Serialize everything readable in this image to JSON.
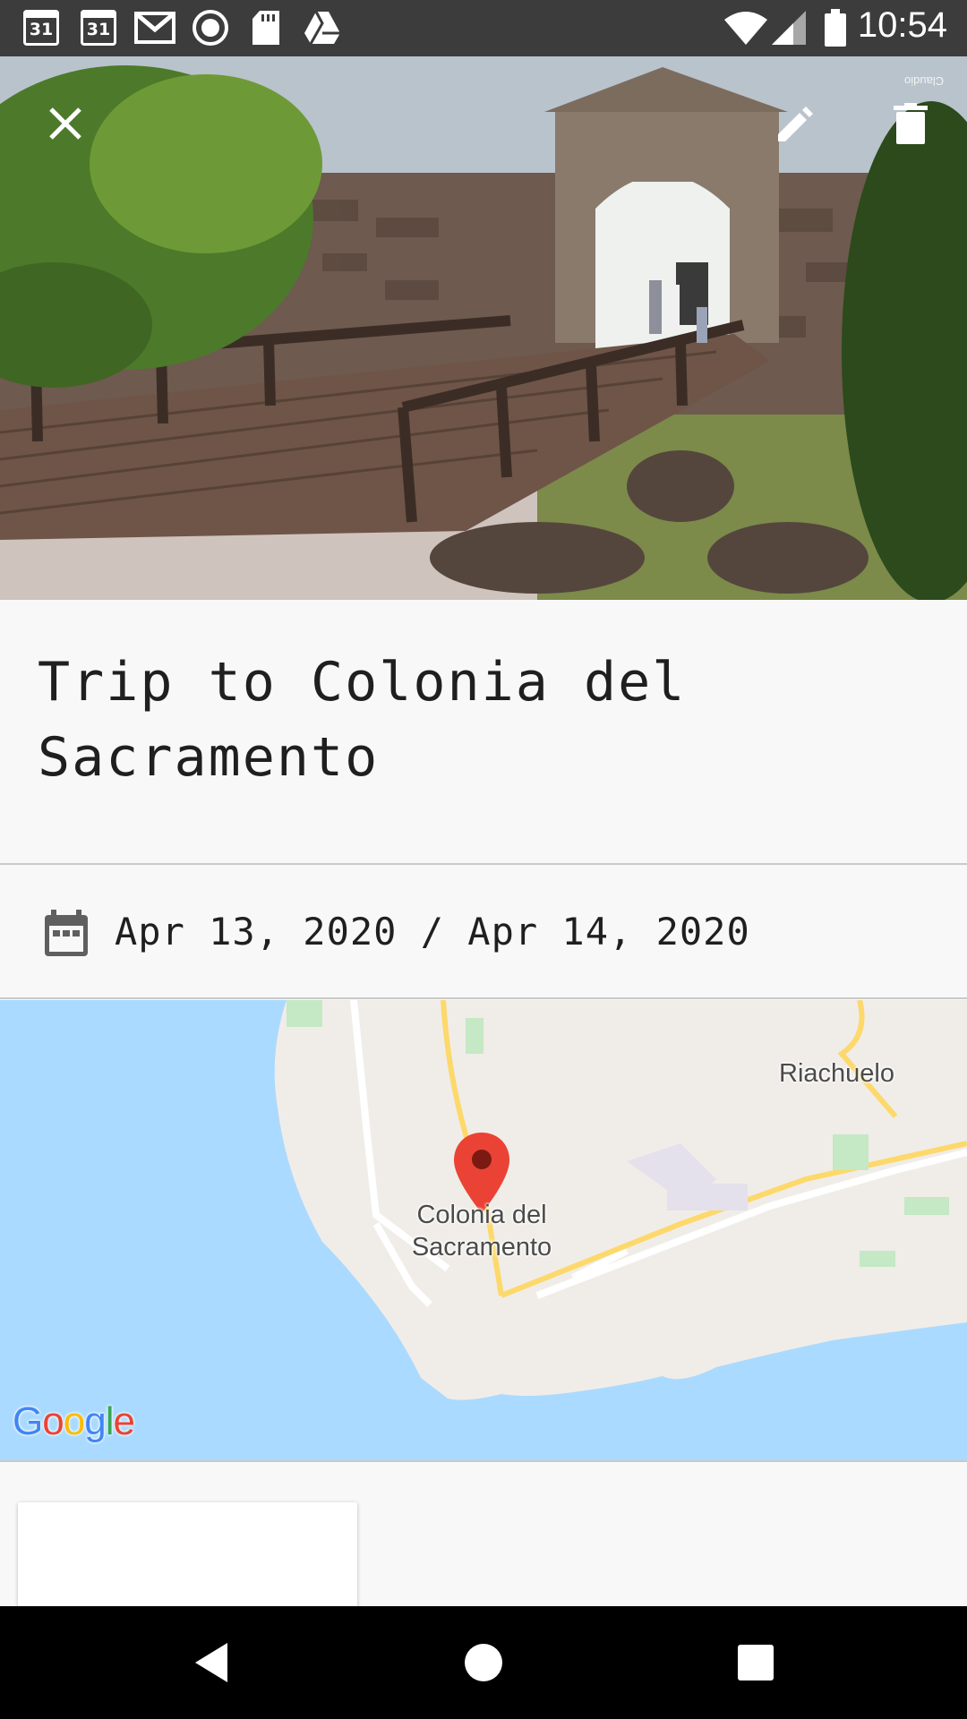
{
  "status_bar": {
    "time": "10:54",
    "calendar_day_1": "31",
    "calendar_day_2": "31",
    "icons": [
      "calendar-icon",
      "calendar-icon",
      "gmail-icon",
      "record-icon",
      "sd-card-icon",
      "drive-icon",
      "wifi-icon",
      "signal-icon",
      "battery-icon"
    ]
  },
  "hero": {
    "close_icon": "close-icon",
    "edit_icon": "edit-pencil-icon",
    "delete_icon": "delete-trash-icon",
    "photo_caption": "Claudio"
  },
  "trip": {
    "title": "Trip to Colonia del Sacramento",
    "dates": "Apr 13, 2020 / Apr 14, 2020",
    "date_icon": "calendar-icon"
  },
  "map": {
    "place_label_main": "Colonia del",
    "place_label_sub": "Sacramento",
    "nearby_label": "Riachuelo",
    "marker_icon": "map-pin-icon",
    "logo_text": "Google",
    "water_color": "#aadaff",
    "land_color": "#f0ede8",
    "marker_color": "#ea4335"
  },
  "nav": {
    "back_icon": "back-icon",
    "home_icon": "home-icon",
    "recents_icon": "recents-icon"
  }
}
